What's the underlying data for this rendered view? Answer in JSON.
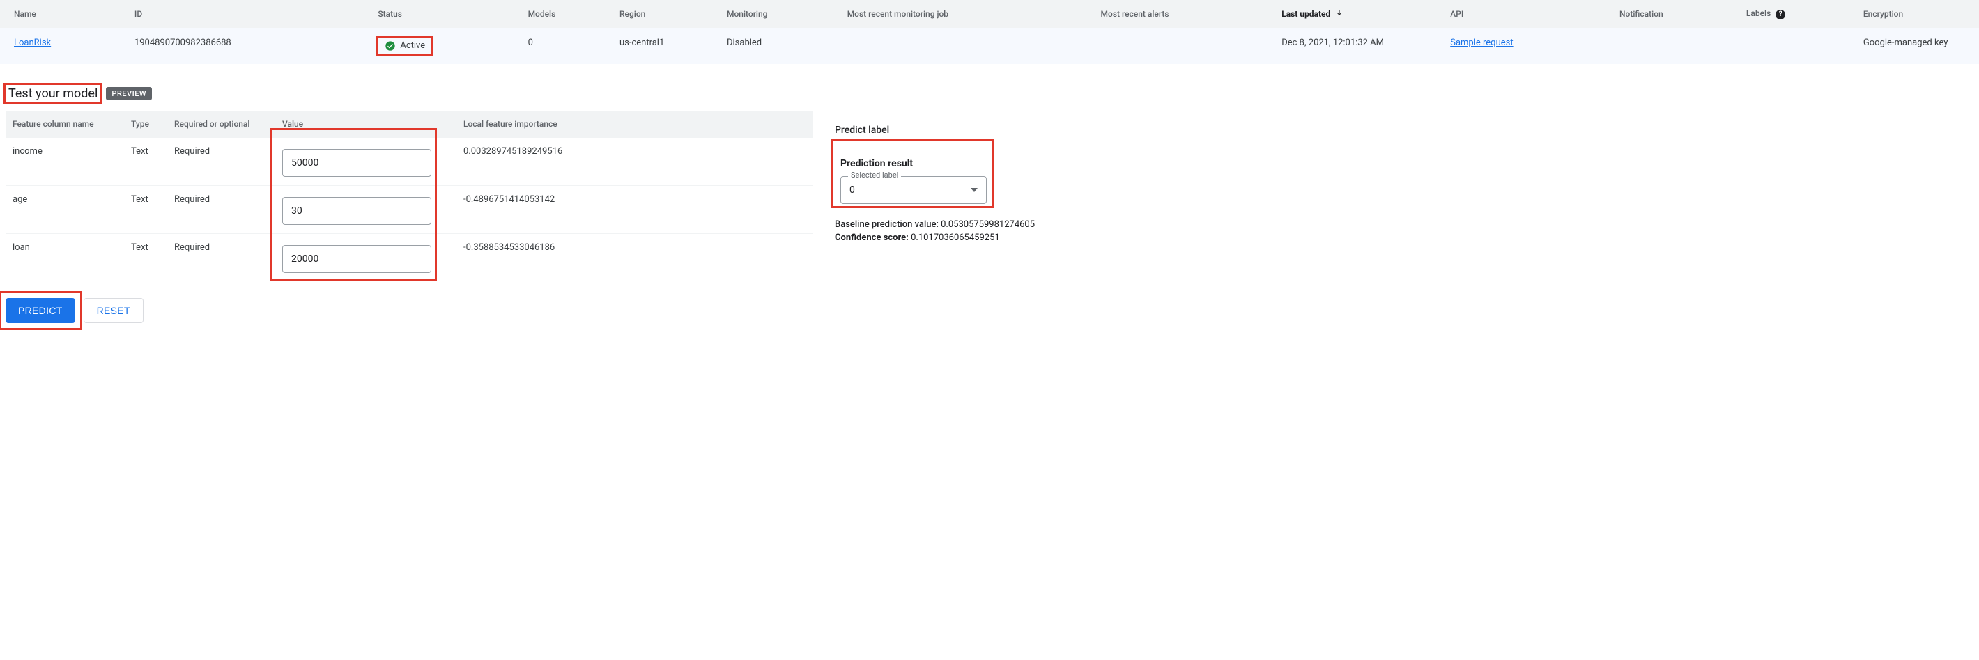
{
  "table": {
    "headers": {
      "name": "Name",
      "id": "ID",
      "status": "Status",
      "models": "Models",
      "region": "Region",
      "monitoring": "Monitoring",
      "most_recent_monitoring": "Most recent monitoring job",
      "most_recent_alerts": "Most recent alerts",
      "last_updated": "Last updated",
      "api": "API",
      "notification": "Notification",
      "labels": "Labels",
      "encryption": "Encryption"
    },
    "row": {
      "name": "LoanRisk",
      "id": "1904890700982386688",
      "status": "Active",
      "models": "0",
      "region": "us-central1",
      "monitoring": "Disabled",
      "most_recent_monitoring": "—",
      "most_recent_alerts": "—",
      "last_updated": "Dec 8, 2021, 12:01:32 AM",
      "api": "Sample request",
      "notification": "",
      "labels": "",
      "encryption": "Google-managed key"
    }
  },
  "section": {
    "title": "Test your model",
    "badge": "PREVIEW"
  },
  "features": {
    "headers": {
      "name": "Feature column name",
      "type": "Type",
      "required": "Required or optional",
      "value": "Value",
      "importance": "Local feature importance"
    },
    "rows": [
      {
        "name": "income",
        "type": "Text",
        "required": "Required",
        "value": "50000",
        "importance": "0.003289745189249516"
      },
      {
        "name": "age",
        "type": "Text",
        "required": "Required",
        "value": "30",
        "importance": "-0.4896751414053142"
      },
      {
        "name": "loan",
        "type": "Text",
        "required": "Required",
        "value": "20000",
        "importance": "-0.3588534533046186"
      }
    ]
  },
  "buttons": {
    "predict": "PREDICT",
    "reset": "RESET"
  },
  "prediction": {
    "predict_label": "Predict label",
    "result_title": "Prediction result",
    "selected_label_caption": "Selected label",
    "selected_label_value": "0",
    "baseline_label": "Baseline prediction value: ",
    "baseline_value": "0.05305759981274605",
    "confidence_label": "Confidence score: ",
    "confidence_value": "0.1017036065459251"
  },
  "icons": {
    "help": "?"
  }
}
